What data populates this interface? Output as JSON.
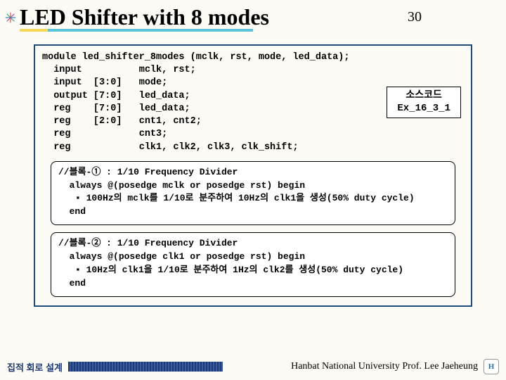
{
  "title": "LED Shifter with 8 modes",
  "page_number": "30",
  "code_declarations": "module led_shifter_8modes (mclk, rst, mode, led_data);\n  input          mclk, rst;\n  input  [3:0]   mode;\n  output [7:0]   led_data;\n  reg    [7:0]   led_data;\n  reg    [2:0]   cnt1, cnt2;\n  reg            cnt3;\n  reg            clk1, clk2, clk3, clk_shift;",
  "source_label": {
    "line1": "소스코드",
    "line2": "Ex_16_3_1"
  },
  "block1": {
    "header": "//블록-① : 1/10 Frequency Divider",
    "always_line": "  always @(posedge mclk or posedge rst) begin",
    "bullet": "100Hz의 mclk를 1/10로 분주하여 10Hz의 clk1을 생성(50% duty cycle)",
    "end_line": "  end"
  },
  "block2": {
    "header": "//블록-② : 1/10 Frequency Divider",
    "always_line": "  always @(posedge clk1 or posedge rst) begin",
    "bullet": "10Hz의 clk1을 1/10로 분주하여 1Hz의 clk2를 생성(50% duty cycle)",
    "end_line": "  end"
  },
  "footer": {
    "left": "집적 회로 설계",
    "right": "Hanbat National University Prof. Lee Jaeheung"
  }
}
